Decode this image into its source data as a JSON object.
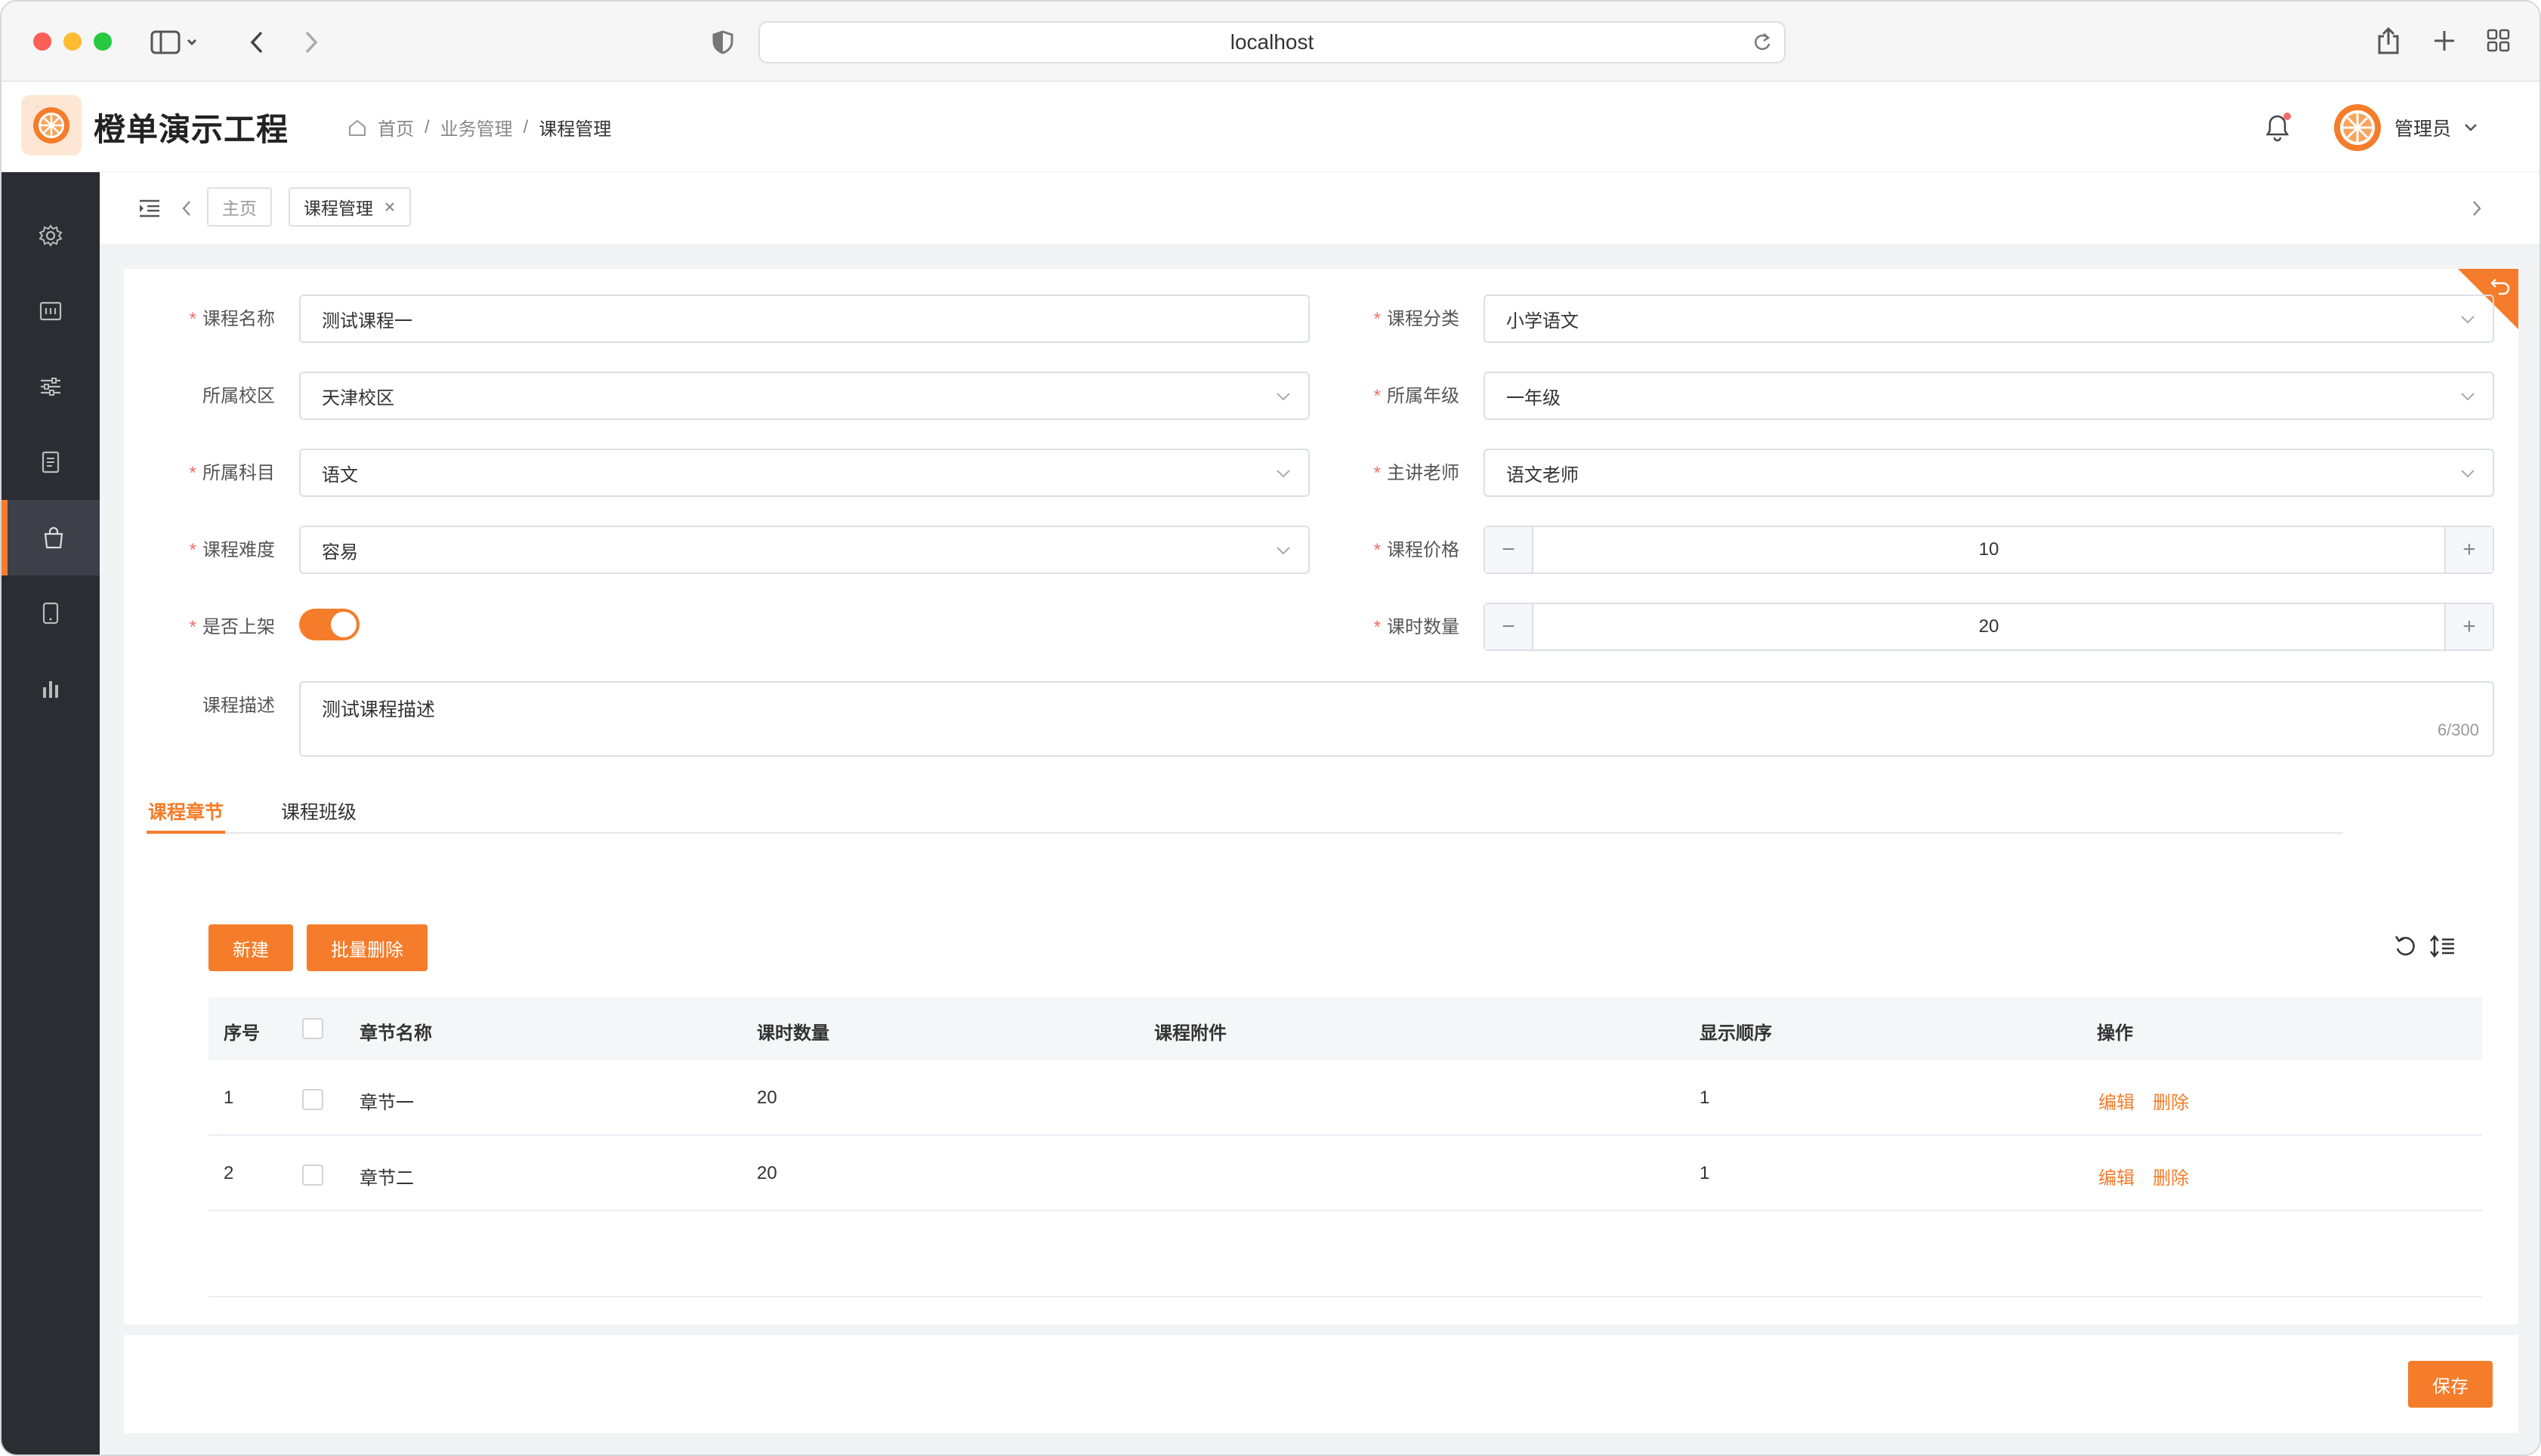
{
  "browser": {
    "url": "localhost"
  },
  "app": {
    "title": "橙单演示工程",
    "user_name": "管理员"
  },
  "breadcrumb": [
    "首页",
    "业务管理",
    "课程管理"
  ],
  "tabs": [
    {
      "label": "主页"
    },
    {
      "label": "课程管理"
    }
  ],
  "form": {
    "name": {
      "label": "课程名称",
      "value": "测试课程一"
    },
    "category": {
      "label": "课程分类",
      "value": "小学语文"
    },
    "campus": {
      "label": "所属校区",
      "value": "天津校区"
    },
    "grade": {
      "label": "所属年级",
      "value": "一年级"
    },
    "subject": {
      "label": "所属科目",
      "value": "语文"
    },
    "teacher": {
      "label": "主讲老师",
      "value": "语文老师"
    },
    "difficulty": {
      "label": "课程难度",
      "value": "容易"
    },
    "price": {
      "label": "课程价格",
      "value": "10"
    },
    "on_shelf": {
      "label": "是否上架",
      "value": true
    },
    "hours": {
      "label": "课时数量",
      "value": "20"
    },
    "description": {
      "label": "课程描述",
      "value": "测试课程描述",
      "count": "6/300"
    }
  },
  "subtabs": [
    "课程章节",
    "课程班级"
  ],
  "buttons": {
    "new": "新建",
    "batch_delete": "批量删除",
    "save": "保存"
  },
  "table": {
    "headers": [
      "序号",
      "章节名称",
      "课时数量",
      "课程附件",
      "显示顺序",
      "操作"
    ],
    "rows": [
      {
        "index": "1",
        "name": "章节一",
        "hours": "20",
        "attachment": "",
        "order": "1",
        "edit": "编辑",
        "delete": "删除"
      },
      {
        "index": "2",
        "name": "章节二",
        "hours": "20",
        "attachment": "",
        "order": "1",
        "edit": "编辑",
        "delete": "删除"
      }
    ]
  },
  "colors": {
    "accent": "#f57c2a",
    "sidebar": "#2b2d33",
    "required": "#f56c6c"
  }
}
